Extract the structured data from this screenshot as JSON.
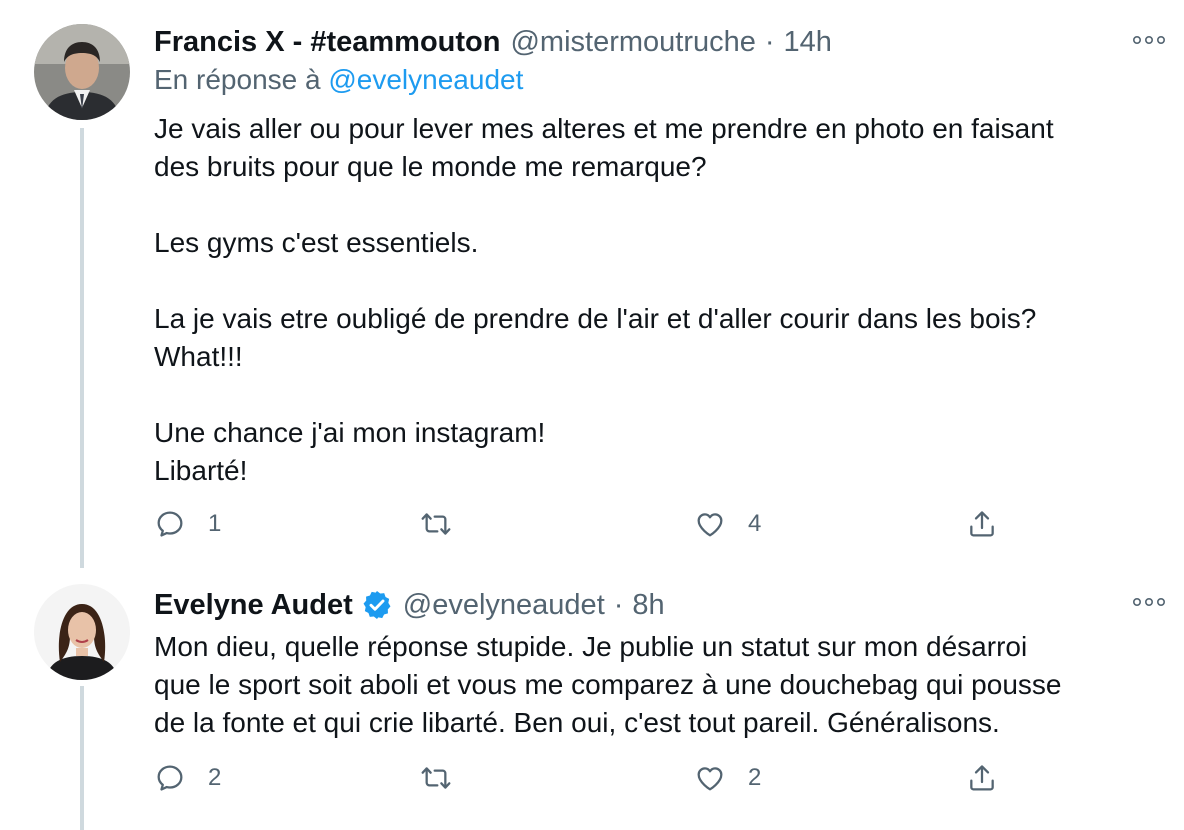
{
  "tweets": [
    {
      "display_name": "Francis X - #teammouton",
      "handle": "@mistermoutruche",
      "separator": "·",
      "time": "14h",
      "reply_prefix": "En réponse à",
      "reply_to": "@evelyneaudet",
      "paragraphs": [
        [
          "Je vais aller ou pour lever mes alteres et me prendre en photo en faisant",
          "des bruits pour que le monde me remarque?"
        ],
        [
          "Les gyms c'est essentiels."
        ],
        [
          "La je vais etre oubligé de prendre de l'air et d'aller courir dans les bois?",
          "What!!!"
        ],
        [
          "Une chance j'ai mon instagram!",
          "Libarté!"
        ]
      ],
      "reply_count": "1",
      "retweet_count": "",
      "like_count": "4",
      "verified": false
    },
    {
      "display_name": "Evelyne Audet",
      "handle": "@evelyneaudet",
      "separator": "·",
      "time": "8h",
      "verified": true,
      "lines": [
        "Mon dieu, quelle réponse stupide. Je publie un statut sur mon désarroi",
        "que le sport soit aboli et vous me comparez à une douchebag qui pousse",
        "de la fonte et qui crie libarté. Ben oui, c'est tout pareil. Généralisons."
      ],
      "reply_count": "2",
      "retweet_count": "",
      "like_count": "2"
    }
  ],
  "colors": {
    "text": "#0f1419",
    "secondary": "#536471",
    "accent": "#1d9bf0",
    "thread_line": "#cfd9de"
  },
  "icons": {
    "more": "more-icon",
    "reply": "reply-icon",
    "retweet": "retweet-icon",
    "like": "like-icon",
    "share": "share-icon",
    "verified": "verified-badge-icon"
  }
}
